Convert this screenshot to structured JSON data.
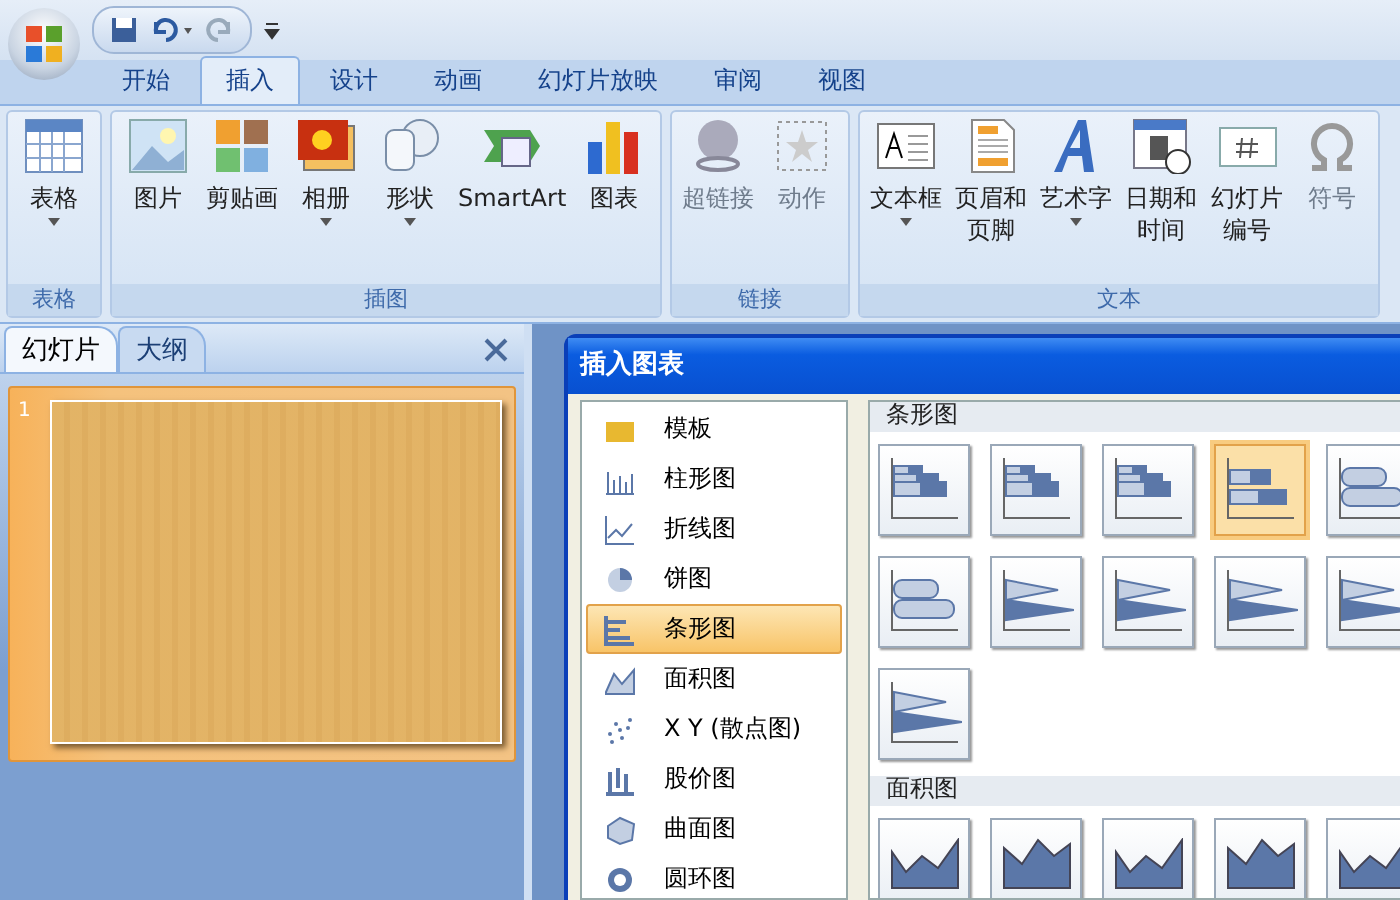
{
  "tabs": [
    {
      "label": "开始",
      "selected": false
    },
    {
      "label": "插入",
      "selected": true
    },
    {
      "label": "设计",
      "selected": false
    },
    {
      "label": "动画",
      "selected": false
    },
    {
      "label": "幻灯片放映",
      "selected": false
    },
    {
      "label": "审阅",
      "selected": false
    },
    {
      "label": "视图",
      "selected": false
    }
  ],
  "ribbon": {
    "groups": [
      {
        "label": "表格",
        "buttons": [
          {
            "label": "表格",
            "dropdown": true,
            "disabled": false
          }
        ]
      },
      {
        "label": "插图",
        "buttons": [
          {
            "label": "图片",
            "dropdown": false,
            "disabled": false
          },
          {
            "label": "剪贴画",
            "dropdown": false,
            "disabled": false
          },
          {
            "label": "相册",
            "dropdown": true,
            "disabled": false
          },
          {
            "label": "形状",
            "dropdown": true,
            "disabled": false
          },
          {
            "label": "SmartArt",
            "dropdown": false,
            "disabled": false
          },
          {
            "label": "图表",
            "dropdown": false,
            "disabled": false
          }
        ]
      },
      {
        "label": "链接",
        "buttons": [
          {
            "label": "超链接",
            "dropdown": false,
            "disabled": true
          },
          {
            "label": "动作",
            "dropdown": false,
            "disabled": true
          }
        ]
      },
      {
        "label": "文本",
        "buttons": [
          {
            "label": "文本框",
            "dropdown": true,
            "disabled": false
          },
          {
            "label": "页眉和页脚",
            "dropdown": false,
            "disabled": false
          },
          {
            "label": "艺术字",
            "dropdown": true,
            "disabled": false
          },
          {
            "label": "日期和时间",
            "dropdown": false,
            "disabled": false
          },
          {
            "label": "幻灯片编号",
            "dropdown": false,
            "disabled": false
          },
          {
            "label": "符号",
            "dropdown": false,
            "disabled": true
          }
        ]
      }
    ]
  },
  "slides_panel": {
    "tabs": [
      {
        "label": "幻灯片",
        "selected": true
      },
      {
        "label": "大纲",
        "selected": false
      }
    ],
    "slides": [
      {
        "number": "1",
        "selected": true
      }
    ]
  },
  "dialog": {
    "title": "插入图表",
    "categories": [
      {
        "label": "模板",
        "selected": false
      },
      {
        "label": "柱形图",
        "selected": false
      },
      {
        "label": "折线图",
        "selected": false
      },
      {
        "label": "饼图",
        "selected": false
      },
      {
        "label": "条形图",
        "selected": true
      },
      {
        "label": "面积图",
        "selected": false
      },
      {
        "label": "X Y (散点图)",
        "selected": false
      },
      {
        "label": "股价图",
        "selected": false
      },
      {
        "label": "曲面图",
        "selected": false
      },
      {
        "label": "圆环图",
        "selected": false
      }
    ],
    "sections": [
      {
        "title": "条形图",
        "kind": "bar",
        "thumbnails": [
          {
            "selected": false
          },
          {
            "selected": false
          },
          {
            "selected": false
          },
          {
            "selected": true
          },
          {
            "selected": false
          },
          {
            "selected": false
          },
          {
            "selected": false
          },
          {
            "selected": false
          },
          {
            "selected": false
          },
          {
            "selected": false
          },
          {
            "selected": false
          }
        ]
      },
      {
        "title": "面积图",
        "kind": "area",
        "thumbnails": [
          {
            "selected": false
          },
          {
            "selected": false
          },
          {
            "selected": false
          },
          {
            "selected": false
          },
          {
            "selected": false
          }
        ]
      }
    ]
  }
}
